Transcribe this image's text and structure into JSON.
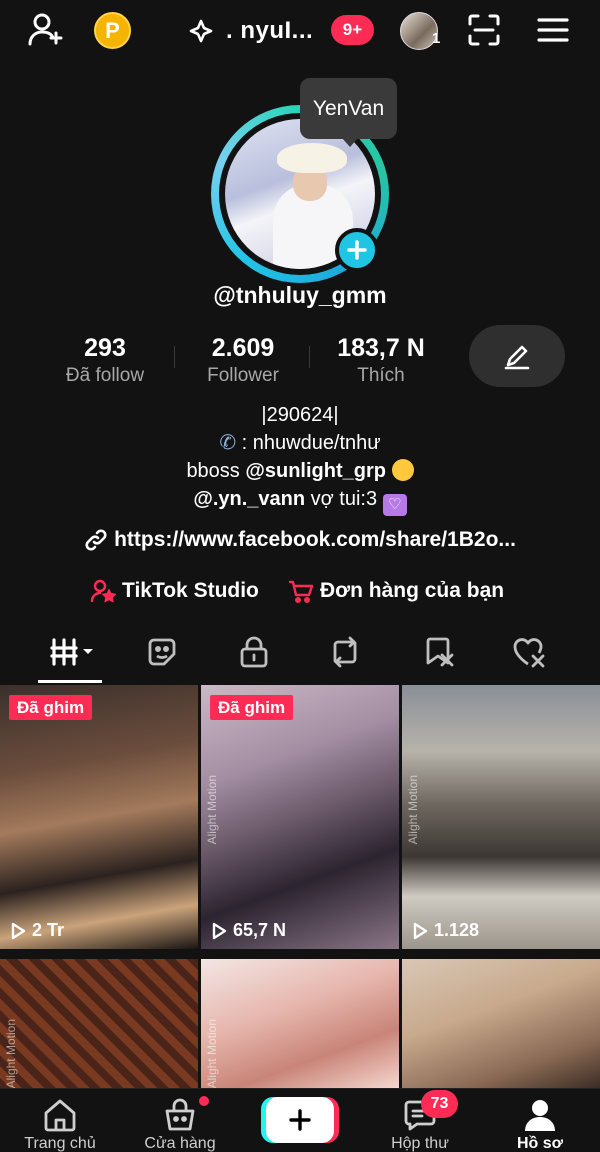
{
  "header": {
    "title": ". nyuI...",
    "notif_badge": "9+",
    "account_count": "1",
    "coin_letter": "P"
  },
  "profile": {
    "tooltip": "YenVan",
    "username": "@tnhuluy_gmm",
    "stats": [
      {
        "value": "293",
        "label": "Đã follow"
      },
      {
        "value": "2.609",
        "label": "Follower"
      },
      {
        "value": "183,7 N",
        "label": "Thích"
      }
    ],
    "bio": {
      "line1": "|290624|",
      "line2": ": nhuwdue/tnhư",
      "line3_prefix": "bboss ",
      "line3_mention": "@sunlight_grp",
      "line4_mention": "@.yn._vann",
      "line4_text": " vợ tui:3"
    },
    "link": "https://www.facebook.com/share/1B2o...",
    "shortcuts": {
      "studio": "TikTok Studio",
      "orders": "Đơn hàng của bạn"
    }
  },
  "grid": {
    "pinned_label": "Đã ghim",
    "watermark": "Alight Motion",
    "videos": [
      {
        "views": "2 Tr",
        "pinned": true
      },
      {
        "views": "65,7 N",
        "pinned": true
      },
      {
        "views": "1.128",
        "pinned": false
      },
      {
        "views": "",
        "pinned": false
      },
      {
        "views": "",
        "pinned": false
      },
      {
        "views": "",
        "pinned": false
      }
    ]
  },
  "bottom_nav": {
    "items": [
      {
        "label": "Trang chủ"
      },
      {
        "label": "Cửa hàng"
      },
      {
        "label": ""
      },
      {
        "label": "Hộp thư"
      },
      {
        "label": "Hồ sơ"
      }
    ],
    "inbox_badge": "73"
  },
  "colors": {
    "accent": "#fe2c55",
    "teal": "#20c5e4",
    "background": "#121212"
  }
}
